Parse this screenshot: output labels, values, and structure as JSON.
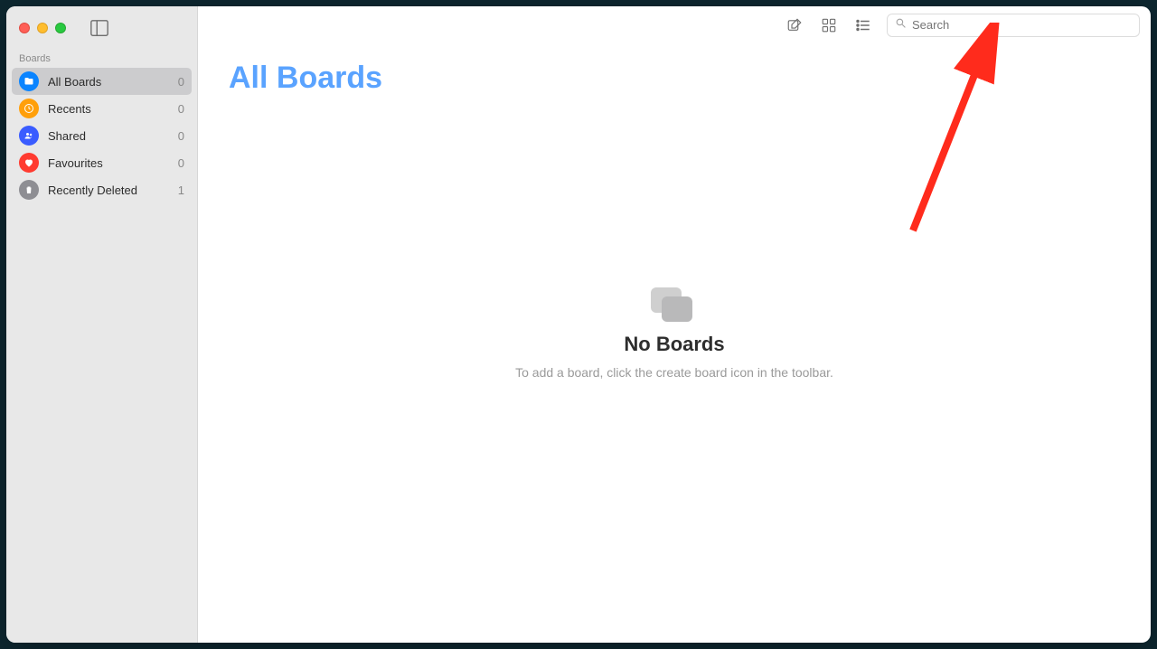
{
  "sidebar": {
    "section_label": "Boards",
    "items": [
      {
        "label": "All Boards",
        "count": "0",
        "icon": "folder-icon",
        "color": "ic-blue",
        "selected": true
      },
      {
        "label": "Recents",
        "count": "0",
        "icon": "clock-icon",
        "color": "ic-orange",
        "selected": false
      },
      {
        "label": "Shared",
        "count": "0",
        "icon": "people-icon",
        "color": "ic-indigo",
        "selected": false
      },
      {
        "label": "Favourites",
        "count": "0",
        "icon": "heart-icon",
        "color": "ic-red",
        "selected": false
      },
      {
        "label": "Recently Deleted",
        "count": "1",
        "icon": "trash-icon",
        "color": "ic-grey",
        "selected": false
      }
    ]
  },
  "toolbar": {
    "search_placeholder": "Search"
  },
  "page": {
    "title": "All Boards"
  },
  "empty": {
    "title": "No Boards",
    "subtitle": "To add a board, click the create board icon in the toolbar."
  }
}
